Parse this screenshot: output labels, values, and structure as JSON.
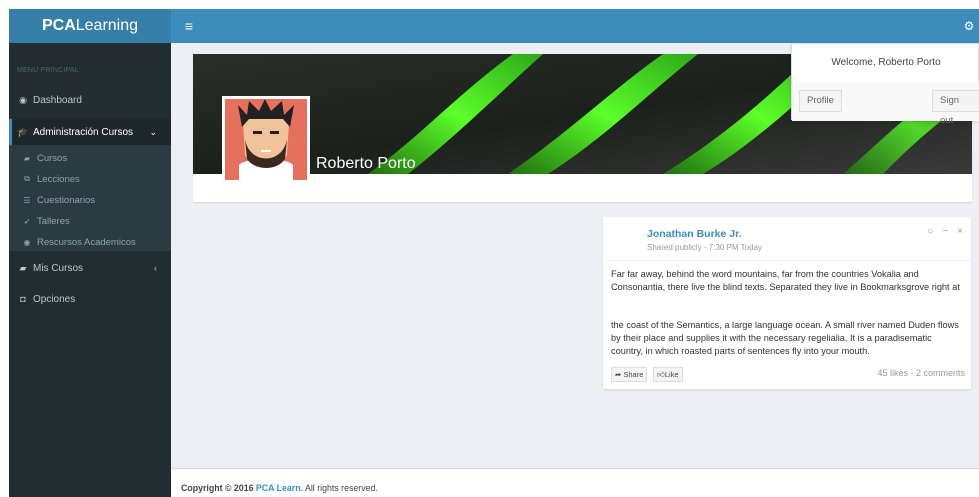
{
  "header": {
    "logo_bold": "PCA",
    "logo_rest": "Learning",
    "toggle_icon": "≡",
    "settings_icon": "gear-icon"
  },
  "sidebar": {
    "header": "MENU PRINCIPAL",
    "items": [
      {
        "label": "Dashboard",
        "icon": "dashboard-icon"
      },
      {
        "label": "Administración Cursos",
        "icon": "graduation-cap-icon",
        "active": true,
        "children": [
          {
            "label": "Cursos",
            "icon": "book-icon"
          },
          {
            "label": "Lecciones",
            "icon": "clone-icon"
          },
          {
            "label": "Cuestionarios",
            "icon": "list-icon"
          },
          {
            "label": "Talleres",
            "icon": "rocket-icon"
          },
          {
            "label": "Rescursos Academicos",
            "icon": "circle-icon"
          }
        ]
      },
      {
        "label": "Mis Cursos",
        "icon": "book-icon"
      },
      {
        "label": "Opciones",
        "icon": "cubes-icon"
      }
    ]
  },
  "profile": {
    "name": "Roberto Porto"
  },
  "user_menu": {
    "welcome": "Welcome, Roberto Porto",
    "profile_btn": "Profile",
    "signout_btn": "Sign out"
  },
  "post": {
    "author": "Jonathan Burke Jr.",
    "meta": "Shared publicly - 7:30 PM Today",
    "paragraph1": "Far far away, behind the word mountains, far from the countries Vokalia and Consonantia, there live the blind texts. Separated they live in Bookmarksgrove right at",
    "paragraph2": "the coast of the Semantics, a large language ocean. A small river named Duden flows by their place and supplies it with the necessary regelialia. It is a paradisematic country, in which roasted parts of sentences fly into your mouth.",
    "share_label": "Share",
    "like_label": "Like",
    "counts": "45 likes - 2 comments"
  },
  "footer": {
    "copyright": "Copyright © 2016 ",
    "link": "PCA Learn.",
    "rights": " All rights reserved."
  },
  "colors": {
    "primary": "#3c8dbc",
    "sidebar": "#222d32",
    "content_bg": "#ecf0f5"
  }
}
